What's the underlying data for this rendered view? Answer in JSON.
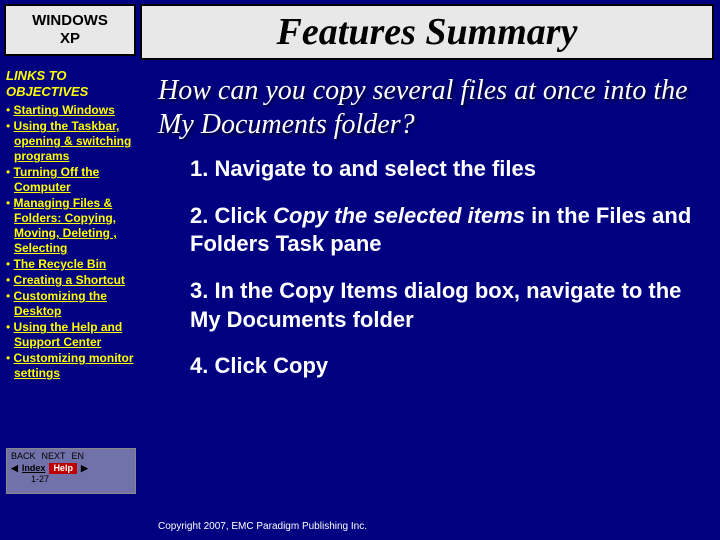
{
  "sidebar": {
    "title_line1": "WINDOWS",
    "title_line2": "XP",
    "links_header": "LINKS TO OBJECTIVES",
    "items": [
      "Starting Windows",
      "Using the Taskbar, opening & switching programs",
      "Turning Off the Computer",
      "Managing Files & Folders: Copying, Moving, Deleting , Selecting",
      "The Recycle Bin",
      "Creating a Shortcut",
      "Customizing the Desktop",
      "Using the Help and Support Center",
      "Customizing monitor settings"
    ]
  },
  "main": {
    "title": "Features Summary",
    "question": "How can you copy several files at once into the My Documents folder?",
    "steps": {
      "s1": "1. Navigate to and select the files",
      "s2a": "2. Click ",
      "s2b": "Copy the selected items",
      "s2c": " in the Files and Folders Task pane",
      "s3": "3. In the Copy Items dialog box, navigate to the My Documents folder",
      "s4": "4. Click Copy"
    }
  },
  "nav": {
    "back": "BACK",
    "next": "NEXT",
    "en": "EN",
    "index": "Index",
    "help": "Help",
    "page": "1-27"
  },
  "footer": {
    "copyright": "Copyright 2007, EMC Paradigm Publishing Inc."
  }
}
